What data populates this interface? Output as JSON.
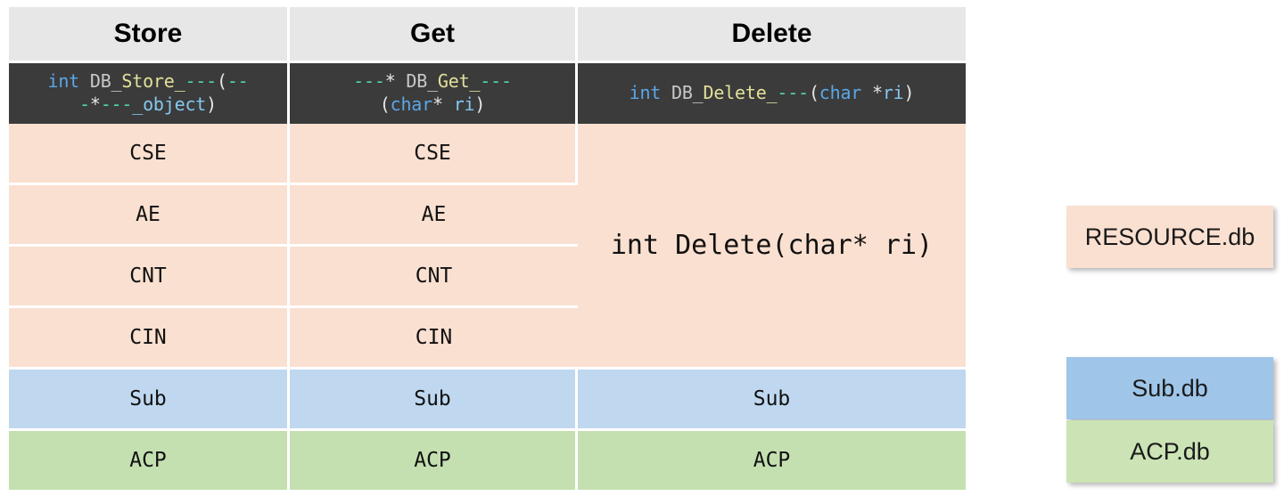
{
  "table": {
    "headers": [
      {
        "label": "Store"
      },
      {
        "label": "Get"
      },
      {
        "label": "Delete"
      }
    ],
    "signature_row": {
      "store": {
        "line1": "int DB_Store_---(--",
        "line2": "-*---_object)",
        "tokens_line1": [
          "int",
          " ",
          "DB_",
          "Store_",
          "---",
          "(",
          "--"
        ],
        "tokens_line2": [
          "-",
          "*",
          "---",
          "_object",
          ")"
        ],
        "t_int": "int",
        "t_db": "DB_",
        "t_fn": "Store_",
        "t_dash1": "---",
        "t_open": "(",
        "t_dash2": "--",
        "t_dash3": "-",
        "t_star": "*",
        "t_dash4": "---",
        "t_obj": "_object",
        "t_close": ")"
      },
      "get": {
        "line1": "---* DB_Get_---",
        "line2": "(char* ri)",
        "t_dash1": "---",
        "t_star1": "*",
        "t_db": "DB_",
        "t_fn": "Get_",
        "t_dash2": "---",
        "t_open": "(",
        "t_char": "char",
        "t_star2": "*",
        "t_ri": "ri",
        "t_close": ")"
      },
      "delete": {
        "line1": "int DB_Delete_---(char *ri)",
        "t_int": "int",
        "t_db": "DB_",
        "t_fn": "Delete_",
        "t_dash": "---",
        "t_open": "(",
        "t_char": "char",
        "t_star": "*",
        "t_ri": "ri",
        "t_close": ")"
      }
    },
    "rows": [
      {
        "store": "CSE",
        "get": "CSE",
        "group": "resource"
      },
      {
        "store": "AE",
        "get": "AE",
        "group": "resource"
      },
      {
        "store": "CNT",
        "get": "CNT",
        "group": "resource"
      },
      {
        "store": "CIN",
        "get": "CIN",
        "group": "resource"
      },
      {
        "store": "Sub",
        "get": "Sub",
        "delete": "Sub",
        "group": "sub"
      },
      {
        "store": "ACP",
        "get": "ACP",
        "delete": "ACP",
        "group": "acp"
      }
    ],
    "delete_merged": "int Delete(char* ri)"
  },
  "legend": {
    "resource": {
      "label": "RESOURCE.db",
      "color": "#fae0d0"
    },
    "sub": {
      "label": "Sub.db",
      "color": "#9fc5e8"
    },
    "acp": {
      "label": "ACP.db",
      "color": "#cbe3b5"
    }
  },
  "colors": {
    "header_bg": "#e7e7e7",
    "code_bg": "#3b3b3b",
    "peach": "#fae0d0",
    "blue": "#bfd8ef",
    "green": "#c4e0b0",
    "grid": "#ffffff",
    "keyword": "#5aa7e8",
    "function": "#e3e09a",
    "placeholder": "#4fd9a5",
    "variable": "#84c7ef",
    "identifier": "#c9c9c9"
  }
}
